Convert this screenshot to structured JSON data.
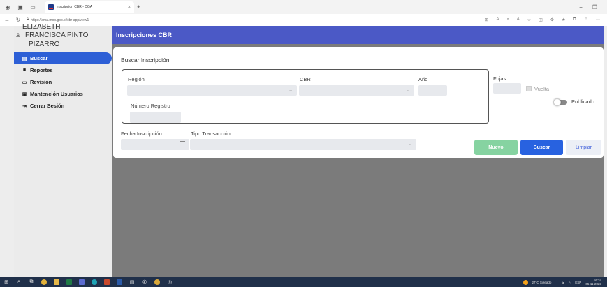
{
  "browser": {
    "tab_title": "Inscripcion CBR - DGA",
    "url": "https://ama.mop.gob.cl/cbr-app/view1",
    "new_tab": "+",
    "close": "×"
  },
  "user": {
    "line1": "ELIZABETH",
    "line2": "FRANCISCA PINTO",
    "line3": "PIZARRO"
  },
  "sidebar": {
    "items": [
      {
        "label": "Buscar",
        "icon": "document-icon"
      },
      {
        "label": "Reportes",
        "icon": "briefcase-icon"
      },
      {
        "label": "Revisión",
        "icon": "monitor-icon"
      },
      {
        "label": "Mantención Usuarios",
        "icon": "id-card-icon"
      },
      {
        "label": "Cerrar Sesión",
        "icon": "logout-icon"
      }
    ]
  },
  "header": {
    "title": "Inscripciones CBR"
  },
  "form": {
    "title": "Buscar Inscripción",
    "region_label": "Región",
    "cbr_label": "CBR",
    "anio_label": "Año",
    "fojas_label": "Fojas",
    "vuelta_label": "Vuelta",
    "publicado_label": "Publicado",
    "numero_registro_label": "Número Registro",
    "fecha_inscripcion_label": "Fecha Inscripción",
    "tipo_transaccion_label": "Tipo Transacción"
  },
  "buttons": {
    "nuevo": "Nuevo",
    "buscar": "Buscar",
    "limpiar": "Limpiar"
  },
  "tray": {
    "weather": "27°C Soleado",
    "lang": "ESP",
    "time": "16:34",
    "date": "05-11-2023"
  },
  "colors": {
    "header": "#4b59c6",
    "active_menu": "#2d5fd6",
    "buscar_button": "#2862e0",
    "nuevo_button": "#86d3a1"
  }
}
